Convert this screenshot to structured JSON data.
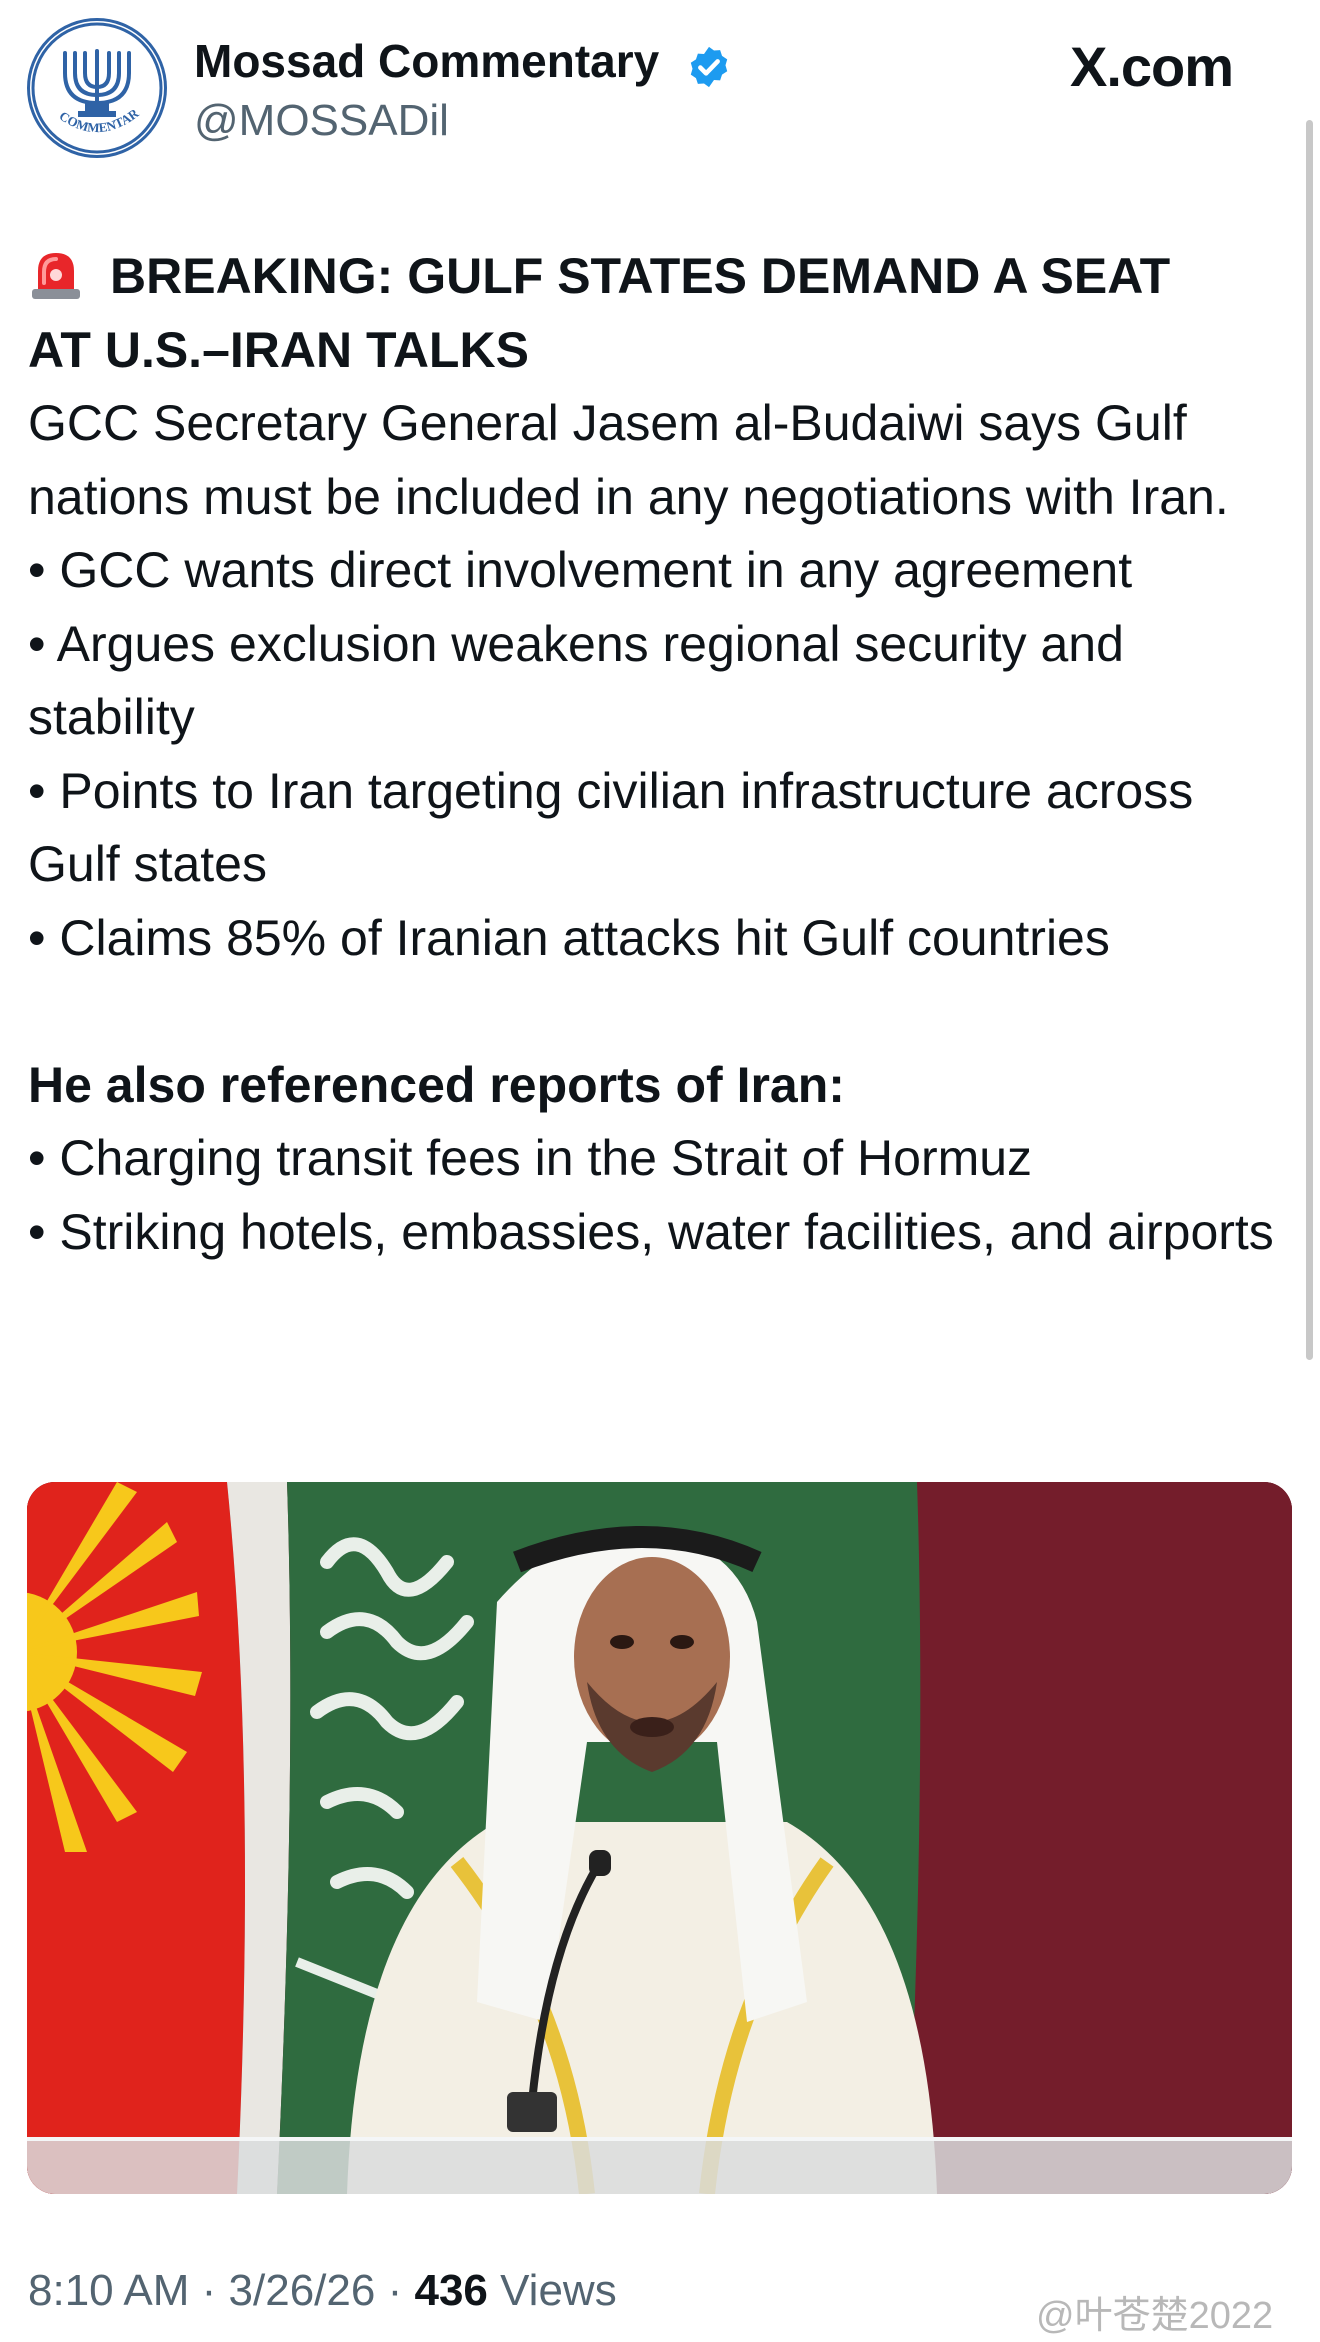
{
  "header": {
    "display_name": "Mossad Commentary",
    "handle": "@MOSSADil",
    "site": "X.com",
    "avatar_label": "COMMENTARY"
  },
  "post": {
    "headline_line1": "BREAKING: GULF STATES DEMAND A SEAT",
    "headline_line2": "AT U.S.–IRAN TALKS",
    "intro": "GCC Secretary General Jasem al-Budaiwi says Gulf nations must be included in any negotiations with Iran.",
    "bullets": [
      "• GCC wants direct involvement in any agreement",
      "• Argues exclusion weakens regional security and stability",
      "• Points to Iran targeting civilian infrastructure across Gulf states",
      "• Claims 85% of Iranian attacks hit Gulf countries"
    ],
    "subheading": "He also referenced reports of Iran:",
    "bullets2": [
      "• Charging transit fees in the Strait of Hormuz",
      "• Striking hotels, embassies, water facilities, and airports"
    ]
  },
  "meta": {
    "time": "8:10 AM",
    "sep1": " · ",
    "date": "3/26/26",
    "sep2": " · ",
    "views_count": "436",
    "views_label": " Views"
  },
  "watermark": "@叶苍楚2022",
  "colors": {
    "text": "#0f1419",
    "secondary": "#536471",
    "verified": "#1d9bf0",
    "flag_red": "#e0231c",
    "flag_green": "#2f6b3f",
    "backdrop": "#6e1b27"
  },
  "icons": [
    "siren-emoji-icon",
    "verified-badge-icon",
    "menorah-logo-icon"
  ]
}
